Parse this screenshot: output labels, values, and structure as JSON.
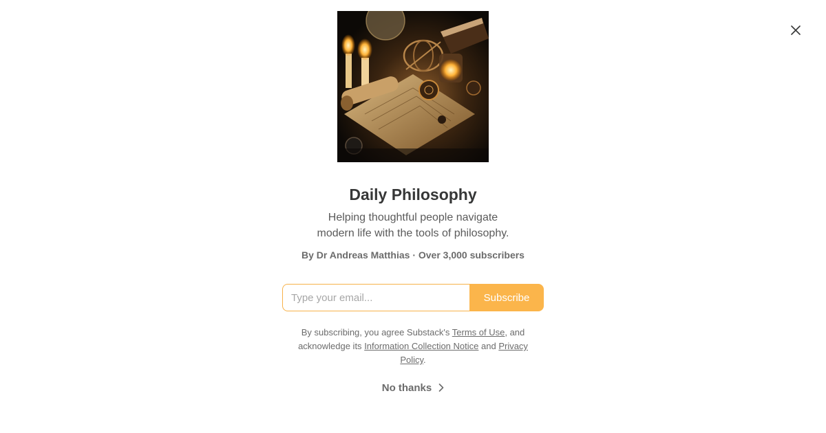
{
  "modal": {
    "close_icon": "close-icon",
    "cover_image": "publication-cover-candlelit-desk-scroll"
  },
  "publication": {
    "name": "Daily Philosophy",
    "description_line1": "Helping thoughtful people navigate",
    "description_line2": "modern life with the tools of philosophy.",
    "byline": "By Dr Andreas Matthias · Over 3,000 subscribers"
  },
  "subscribe_form": {
    "email_placeholder": "Type your email...",
    "email_value": "",
    "button_label": "Subscribe",
    "accent_color": "#fbb54b"
  },
  "legal": {
    "prefix": "By subscribing, you agree Substack's ",
    "terms_link": "Terms of Use",
    "mid1": ", and acknowledge its ",
    "info_link": "Information Collection Notice",
    "mid2": " and ",
    "privacy_link": "Privacy Policy",
    "suffix": "."
  },
  "dismiss": {
    "label": "No thanks",
    "icon": "chevron-right-icon"
  }
}
